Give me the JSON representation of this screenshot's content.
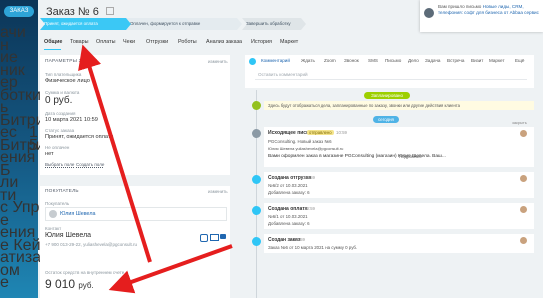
{
  "sidebar": {
    "logo_label": "ЗАКАЗ",
    "items": [
      {
        "label": "ачи",
        "badge": ""
      },
      {
        "label": "н",
        "badge": ""
      },
      {
        "label": "ие",
        "badge": ""
      },
      {
        "label": "ник",
        "badge": ""
      },
      {
        "label": "ер",
        "badge": ""
      },
      {
        "label": "ботки",
        "badge": ""
      },
      {
        "label": "ь",
        "badge": ""
      },
      {
        "label": "Битрикс24",
        "badge": ""
      },
      {
        "label": "ес",
        "badge": "1"
      },
      {
        "label": "Битрикс24",
        "badge": "5"
      },
      {
        "label": "ения",
        "badge": ""
      },
      {
        "label": "Б",
        "badge": ""
      },
      {
        "label": "ли",
        "badge": ""
      },
      {
        "label": "ти",
        "badge": ""
      },
      {
        "label": "с Управл...",
        "badge": ""
      },
      {
        "label": "е",
        "badge": ""
      },
      {
        "label": "ения",
        "badge": ""
      },
      {
        "label": "е Кейсы",
        "badge": ""
      },
      {
        "label": "атизация",
        "badge": ""
      },
      {
        "label": "ом",
        "badge": ""
      },
      {
        "label": "е",
        "badge": ""
      }
    ]
  },
  "header": {
    "title": "Заказ №",
    "number": "6"
  },
  "stages": [
    "Принят, ожидается оплата",
    "Оплачен, формируется к отправке",
    "Завершить обработку"
  ],
  "notification": {
    "text_prefix": "Вам пришло письмо",
    "text_link": "Новые лиды, CRM, телефония: софт для бизнеса от Abbaa сервис"
  },
  "tabs": [
    "Общие",
    "Товары",
    "Оплаты",
    "Чеки",
    "Отгрузки",
    "Роботы",
    "Анализ заказа",
    "История",
    "Маркет"
  ],
  "order_card": {
    "header": "ПАРАМЕТРЫ ЗАКАЗА",
    "change_label": "изменить",
    "payer_type_label": "Тип плательщика",
    "payer_type_value": "Физическое лицо",
    "total_label": "Сумма и валюта",
    "total_value": "0 руб.",
    "date_label": "Дата создания",
    "date_value": "10 марта 2021 10:59",
    "status_label": "Статус заказа",
    "status_value": "Принят, ожидается оплата",
    "paid_label": "Не оплачен",
    "paid_value": "нет",
    "select_field": "Выбрать поле",
    "create_field": "Создать поле"
  },
  "buyer_card": {
    "header": "ПОКУПАТЕЛЬ",
    "change_label": "изменить",
    "buyer_label": "Покупатель",
    "buyer_name": "Юлия Шевела",
    "contact_label": "Контакт",
    "contact_name": "Юлия Шевела",
    "contact_phone": "+7 900 013-29-22, yuliashevela@pgconsult.ru",
    "remainder_label": "Остаток средств на внутреннем счете",
    "remainder_value": "9 010",
    "remainder_currency": "руб."
  },
  "composer": {
    "tabs": [
      "Комментарий",
      "Ждать",
      "Zoom",
      "Звонок",
      "SMS",
      "Письмо",
      "Дело",
      "Задача",
      "Встреча",
      "Визит",
      "Маркет",
      "Ещё"
    ],
    "placeholder": "Оставить комментарий"
  },
  "timeline": {
    "scheduled_badge": "Запланировано",
    "scheduled_text": "Здесь будут отображаться дела, запланированные по заказу, звонки или другие действия клиента",
    "today_badge": "сегодня",
    "email": {
      "title": "Исходящее письмо",
      "status": "отправлено",
      "time": "10:59",
      "subject": "PGConsulting. Новый заказ №6",
      "from": "Юлия Шевела yuliashevela@pgconsult.ru",
      "body": "Вами оформлен заказ в магазине PGConsulting (магазин) Юлия Шевела. Ваш...",
      "more": "Подробнее",
      "flag": "закрыть"
    },
    "shipment": {
      "title": "Создана отгрузка",
      "time": "10:59",
      "link": "№6/2 от 10.03.2021",
      "note": "Добавлена заказу: 6"
    },
    "payment": {
      "title": "Создана оплата",
      "time": "10:59",
      "link": "№6/1 от 10.03.2021",
      "note": "Добавлена заказу: 6"
    },
    "order": {
      "title": "Создан заказ",
      "time": "10:59",
      "text": "Заказ №6 от 10 марта 2021 на сумму 0 руб."
    }
  },
  "colors": {
    "accent": "#2fc7f7",
    "arrow": "#e51e1e",
    "sidebar_top": "#0c3557",
    "sidebar_bottom": "#1f86b4"
  }
}
